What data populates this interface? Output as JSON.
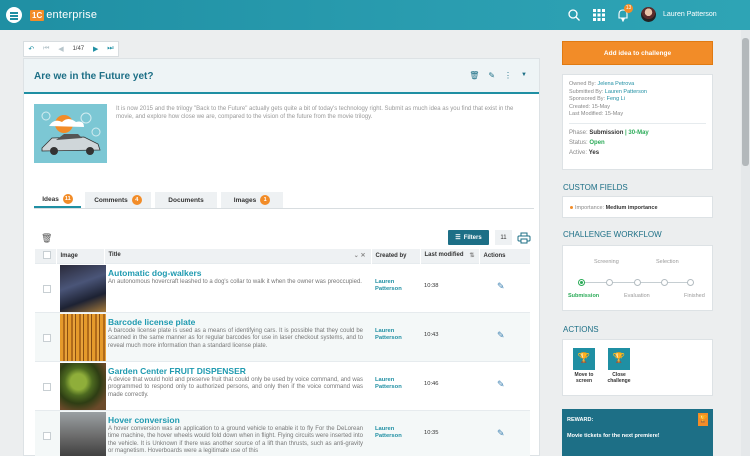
{
  "app": {
    "logo_badge": "1C",
    "logo_text": "enterprise",
    "user_name": "Lauren Patterson",
    "notifications": "13"
  },
  "pager": {
    "position": "1/47"
  },
  "challenge": {
    "title": "Are we in the Future yet?",
    "description": "It is now 2015 and the trilogy \"Back to the Future\" actually gets quite a bit of today's technology right. Submit as much idea as you find that exist in the movie, and explore how close we are, compared to the vision of the future from the movie trilogy."
  },
  "tabs": [
    {
      "label": "Ideas",
      "badge": "11"
    },
    {
      "label": "Comments",
      "badge": "4"
    },
    {
      "label": "Documents",
      "badge": ""
    },
    {
      "label": "Images",
      "badge": "1"
    }
  ],
  "toolbar": {
    "filters_label": "Filters",
    "result_count": "11"
  },
  "table": {
    "headers": {
      "image": "Image",
      "title": "Title",
      "created_by": "Created by",
      "last_modified": "Last modified",
      "actions": "Actions"
    },
    "rows": [
      {
        "title": "Automatic dog-walkers",
        "description": "An autonomous hovercraft leashed to a dog's collar to walk it when the owner was preoccupied.",
        "creator": "Lauren Patterson",
        "modified": "10:38"
      },
      {
        "title": "Barcode license plate",
        "description": "A barcode license plate is used as a means of identifying cars. It is possible that they could be scanned in the same manner as for regular barcodes for use in laser checkout systems, and to reveal much more information than a standard license plate.",
        "creator": "Lauren Patterson",
        "modified": "10:43"
      },
      {
        "title": "Garden Center FRUIT DISPENSER",
        "description": "A device that would hold and preserve fruit that could only be used by voice command, and was programmed to respond only to authorized persons, and only then if the voice command was made correctly.",
        "creator": "Lauren Patterson",
        "modified": "10:46"
      },
      {
        "title": "Hover conversion",
        "description": "A hover conversion was an application to a ground vehicle to enable it to fly For the DeLorean time machine, the hover wheels would fold down when in flight. Flying circuits were inserted into the vehicle. It is Unknown if there was another source of a lift than thrusts, such as anti-gravity or magnetism. Hoverboards were a legitimate use of this",
        "creator": "Lauren Patterson",
        "modified": "10:35"
      }
    ]
  },
  "side": {
    "add_button": "Add idea to challenge",
    "owned_by_label": "Owned By:",
    "owned_by": "Jelena Petrova",
    "submitted_by_label": "Submitted By:",
    "submitted_by": "Lauren Patterson",
    "sponsored_by_label": "Sponsored By:",
    "sponsored_by": "Feng Li",
    "created_label": "Created:",
    "created": "15-May",
    "last_modified_label": "Last Modified:",
    "last_modified": "15-May",
    "phase_label": "Phase:",
    "phase": "Submission",
    "phase_date": "| 30-May",
    "status_label": "Status:",
    "status": "Open",
    "active_label": "Active:",
    "active": "Yes",
    "custom_fields_title": "CUSTOM FIELDS",
    "importance_label": "Importance:",
    "importance": "Medium importance",
    "workflow_title": "CHALLENGE WORKFLOW",
    "workflow": {
      "screening": "Screening",
      "selection": "Selection",
      "submission": "Submission",
      "evaluation": "Evaluation",
      "finished": "Finished"
    },
    "actions_title": "ACTIONS",
    "actions": [
      {
        "label": "Move to screen"
      },
      {
        "label": "Close challenge"
      }
    ],
    "reward_title": "REWARD:",
    "reward_text": "Movie tickets for the next premiere!"
  },
  "colors": {
    "primary": "#1f8fa3",
    "accent": "#f28c28",
    "title": "#1d6f86",
    "success": "#2bab58"
  }
}
